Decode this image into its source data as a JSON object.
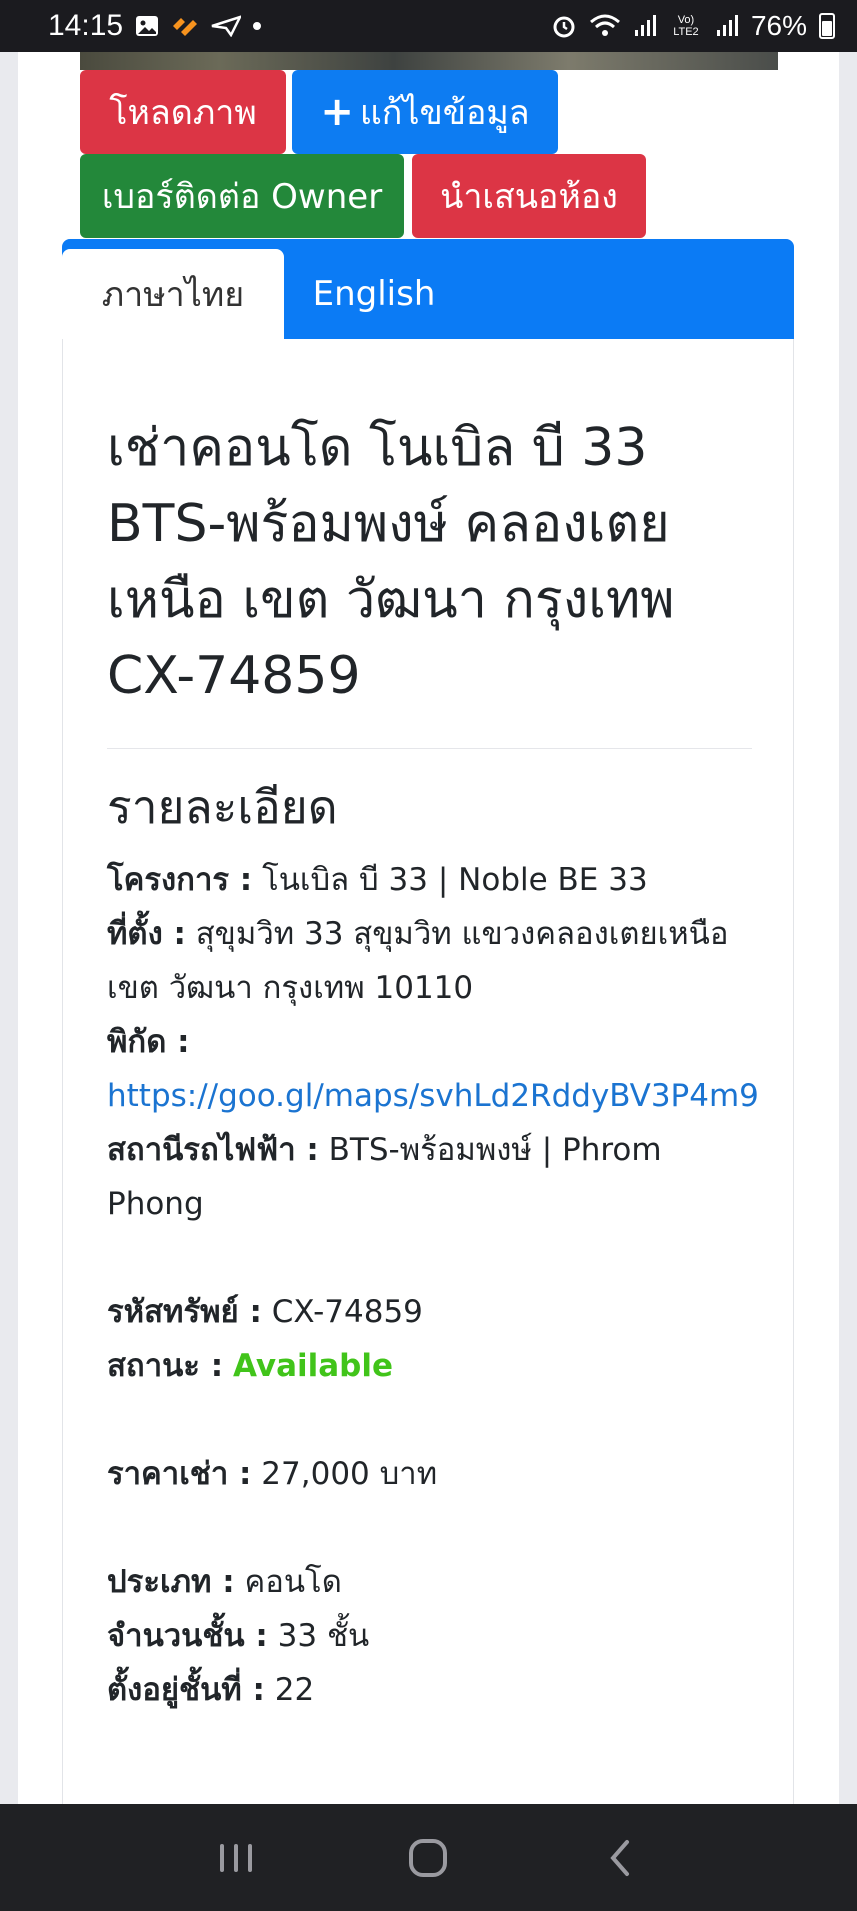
{
  "status_bar": {
    "time": "14:15",
    "battery": "76%",
    "icons": [
      "image-icon",
      "brand-app-icon",
      "send-icon",
      "dot-icon",
      "alarm-icon",
      "wifi-icon",
      "signal-icon",
      "volte-icon",
      "signal-icon-2",
      "battery-icon"
    ],
    "volte_label": "Vo) LTE2"
  },
  "buttons": {
    "upload": "โหลดภาพ",
    "edit": "แก้ไขข้อมูล",
    "contact_owner": "เบอร์ติดต่อ Owner",
    "offer_room": "นำเสนอห้อง"
  },
  "tabs": [
    {
      "label": "ภาษาไทย",
      "active": true
    },
    {
      "label": "English",
      "active": false
    }
  ],
  "listing": {
    "title": "เช่าคอนโด โนเบิล บี 33 BTS-พร้อมพงษ์ คลองเตยเหนือ เขต วัฒนา กรุงเทพ CX-74859",
    "section_title": "รายละเอียด",
    "project_label": "โครงการ :",
    "project_value": "โนเบิล บี 33 | Noble BE 33",
    "location_label": "ที่ตั้ง :",
    "location_value": "สุขุมวิท 33 สุขุมวิท แขวงคลองเตยเหนือ เขต วัฒนา กรุงเทพ 10110",
    "coords_label": "พิกัด :",
    "coords_link": "https://goo.gl/maps/svhLd2RddyBV3P4m9",
    "station_label": "สถานีรถไฟฟ้า :",
    "station_value": "BTS-พร้อมพงษ์ | Phrom Phong",
    "code_label": "รหัสทรัพย์ :",
    "code_value": "CX-74859",
    "status_label": "สถานะ :",
    "status_value": "Available",
    "price_label": "ราคาเช่า :",
    "price_value": "27,000 บาท",
    "type_label": "ประเภท :",
    "type_value": "คอนโด",
    "floors_label": "จำนวนชั้น :",
    "floors_value": "33 ชั้น",
    "floor_label": "ตั้งอยู่ชั้นที่ :",
    "floor_value": "22"
  },
  "colors": {
    "red": "#dc3545",
    "blue": "#0d7cf2",
    "green": "#23883a",
    "link": "#1b74d1",
    "available": "#41c41a"
  },
  "nav": [
    "recent-apps-icon",
    "home-icon",
    "back-icon"
  ]
}
